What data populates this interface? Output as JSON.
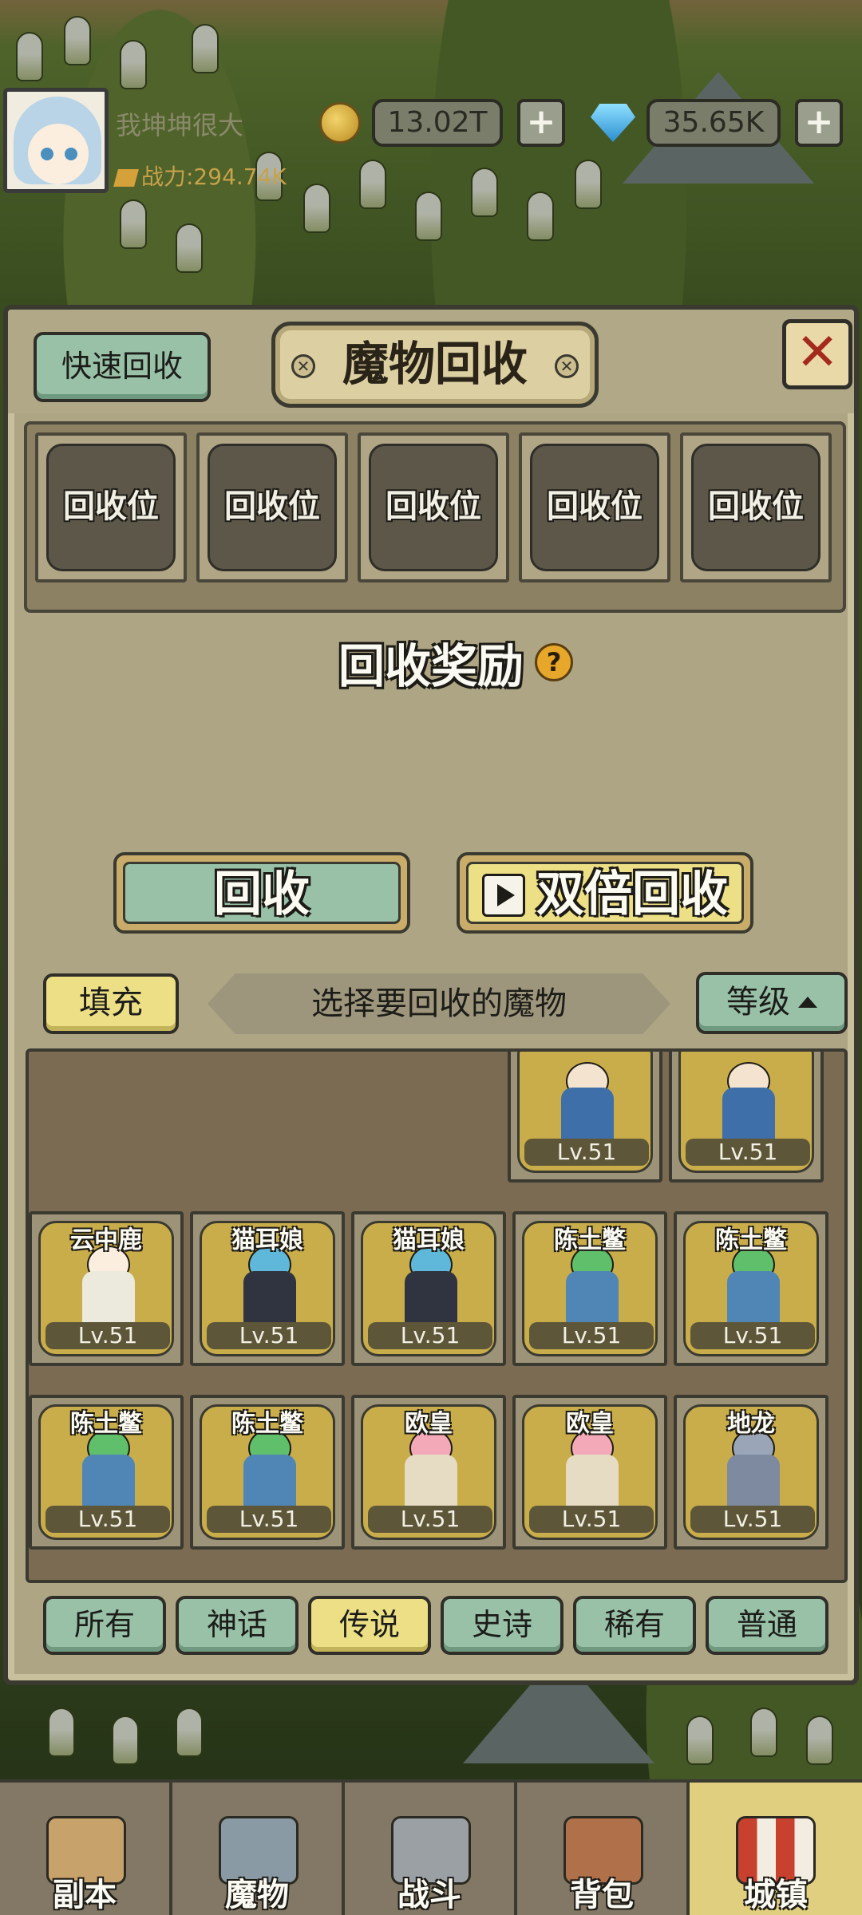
{
  "player": {
    "name": "我坤坤很大",
    "power": "战力:294.74K",
    "gold": "13.02T",
    "gems": "35.65K",
    "plus": "+"
  },
  "panel": {
    "title": "魔物回收",
    "quick_recycle": "快速回收",
    "close": "✕",
    "slots": [
      "回收位",
      "回收位",
      "回收位",
      "回收位",
      "回收位"
    ],
    "reward_title": "回收奖励",
    "help": "?",
    "recycle": "回收",
    "double_recycle": "双倍回收",
    "fill": "填充",
    "select_hint": "选择要回收的魔物",
    "sort": "等级"
  },
  "monsters": [
    {
      "name": "",
      "level": "Lv.51",
      "color": "#3f6fa8"
    },
    {
      "name": "",
      "level": "Lv.51",
      "color": "#3f6fa8"
    },
    {
      "name": "云中鹿",
      "level": "Lv.51",
      "color": "#eceadc"
    },
    {
      "name": "猫耳娘",
      "level": "Lv.51",
      "color": "#5fb7d9"
    },
    {
      "name": "猫耳娘",
      "level": "Lv.51",
      "color": "#5fb7d9"
    },
    {
      "name": "陈土鳖",
      "level": "Lv.51",
      "color": "#4f86b5"
    },
    {
      "name": "陈土鳖",
      "level": "Lv.51",
      "color": "#4f86b5"
    },
    {
      "name": "陈土鳖",
      "level": "Lv.51",
      "color": "#4f86b5"
    },
    {
      "name": "陈土鳖",
      "level": "Lv.51",
      "color": "#4f86b5"
    },
    {
      "name": "欧皇",
      "level": "Lv.51",
      "color": "#f4a9b8"
    },
    {
      "name": "欧皇",
      "level": "Lv.51",
      "color": "#f4a9b8"
    },
    {
      "name": "地龙",
      "level": "Lv.51",
      "color": "#7d8aa0"
    }
  ],
  "filter_tabs": [
    "所有",
    "神话",
    "传说",
    "史诗",
    "稀有",
    "普通"
  ],
  "active_filter": "传说",
  "nav": [
    "副本",
    "魔物",
    "战斗",
    "背包",
    "城镇"
  ],
  "active_nav": "城镇",
  "colors": {
    "panel": "#aea584",
    "teal_button": "#98c1a8",
    "yellow_button": "#ecdf86",
    "card_bg": "#c9ad4a",
    "close_x": "#a52a1e"
  }
}
